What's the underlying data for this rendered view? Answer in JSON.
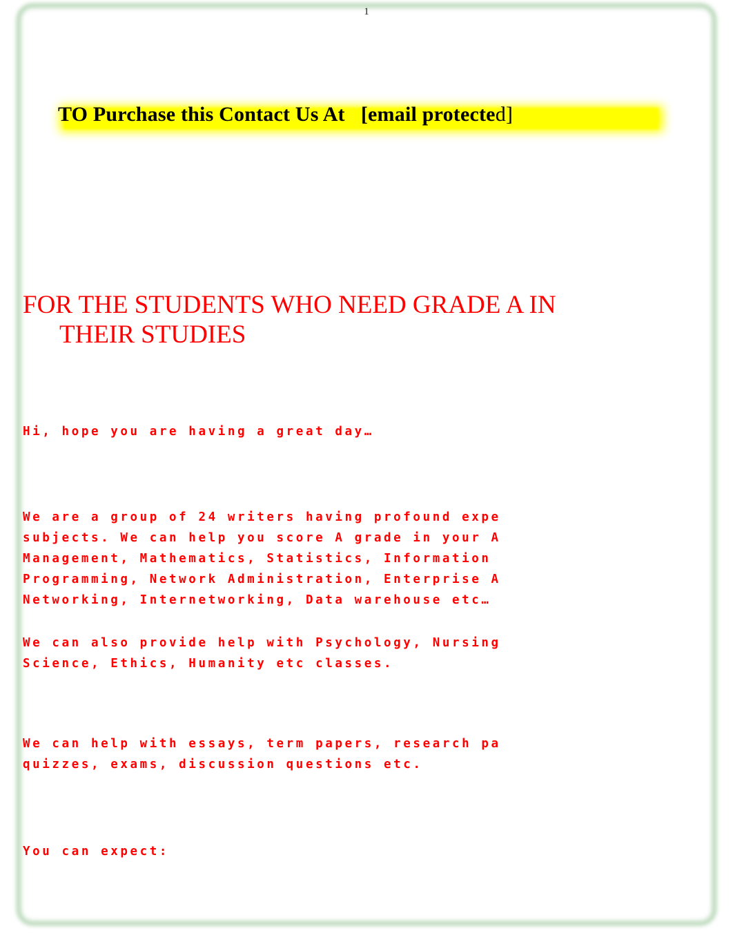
{
  "page": {
    "number": "1",
    "border_color": "#8fbf8f",
    "background": "#ffffff"
  },
  "contact_banner": {
    "text_main": "TO Purchase this Contact Us At   [email protecte",
    "text_tail": "d]",
    "highlight_color": "#ffff00",
    "text_color": "#000000"
  },
  "heading": {
    "line1": "FOR THE STUDENTS WHO NEED GRADE A IN",
    "line2": "THEIR STUDIES",
    "color": "#ff0000"
  },
  "body": {
    "color": "#ff0000",
    "greeting": {
      "line1": "Hi, hope you are having a great day…"
    },
    "writers": {
      "line1": "We are a group of 24 writers having profound expe",
      "line2": "subjects. We can help you score A grade in your A",
      "line3": "Management, Mathematics, Statistics, Information",
      "line4": "Programming, Network Administration, Enterprise A",
      "line5": "Networking, Internetworking, Data warehouse etc…"
    },
    "also": {
      "line1": "We can also provide help with Psychology, Nursing",
      "line2": "Science, Ethics, Humanity etc classes."
    },
    "help": {
      "line1": "We can help with essays, term papers, research pa",
      "line2": "quizzes, exams, discussion questions etc."
    },
    "expect": {
      "line1": "You can expect:"
    }
  }
}
